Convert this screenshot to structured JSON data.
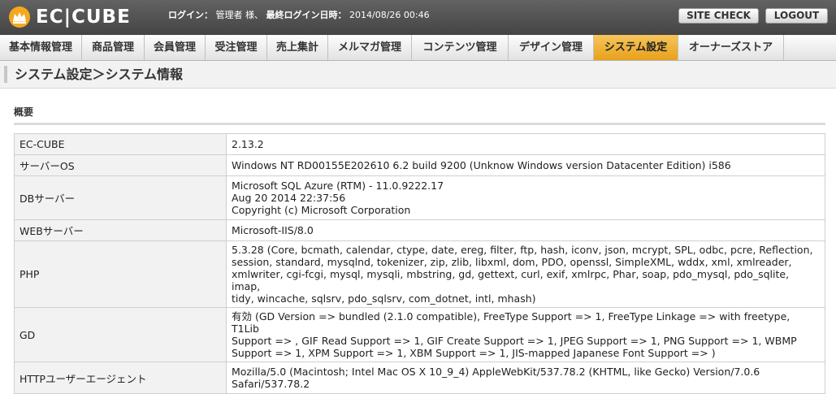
{
  "header": {
    "logo_text": "EC|CUBE",
    "login_label": "ログイン：",
    "user_name": "管理者 様、",
    "last_login_label": "最終ログイン日時：",
    "last_login_value": "2014/08/26 00:46",
    "site_check_label": "SITE CHECK",
    "logout_label": "LOGOUT",
    "brand_color": "#f4a91c"
  },
  "nav": {
    "items": [
      {
        "label": "基本情報管理"
      },
      {
        "label": "商品管理"
      },
      {
        "label": "会員管理"
      },
      {
        "label": "受注管理"
      },
      {
        "label": "売上集計"
      },
      {
        "label": "メルマガ管理"
      },
      {
        "label": "コンテンツ管理"
      },
      {
        "label": "デザイン管理"
      },
      {
        "label": "システム設定",
        "active": true
      },
      {
        "label": "オーナーズストア"
      }
    ],
    "active_color": "#f0b23b"
  },
  "page": {
    "title": "システム設定＞システム情報",
    "section_title": "概要"
  },
  "table": {
    "rows": [
      {
        "label": "EC-CUBE",
        "value": "2.13.2"
      },
      {
        "label": "サーバーOS",
        "value": "Windows NT RD00155E202610 6.2 build 9200 (Unknow Windows version Datacenter Edition) i586"
      },
      {
        "label": "DBサーバー",
        "value": "Microsoft SQL Azure (RTM) - 11.0.9222.17\nAug 20 2014 22:37:56\nCopyright (c) Microsoft Corporation"
      },
      {
        "label": "WEBサーバー",
        "value": "Microsoft-IIS/8.0"
      },
      {
        "label": "PHP",
        "value": "5.3.28 (Core, bcmath, calendar, ctype, date, ereg, filter, ftp, hash, iconv, json, mcrypt, SPL, odbc, pcre, Reflection,\nsession, standard, mysqlnd, tokenizer, zip, zlib, libxml, dom, PDO, openssl, SimpleXML, wddx, xml, xmlreader,\nxmlwriter, cgi-fcgi, mysql, mysqli, mbstring, gd, gettext, curl, exif, xmlrpc, Phar, soap, pdo_mysql, pdo_sqlite, imap,\ntidy, wincache, sqlsrv, pdo_sqlsrv, com_dotnet, intl, mhash)"
      },
      {
        "label": "GD",
        "value": "有効 (GD Version => bundled (2.1.0 compatible), FreeType Support => 1, FreeType Linkage => with freetype, T1Lib\nSupport => , GIF Read Support => 1, GIF Create Support => 1, JPEG Support => 1, PNG Support => 1, WBMP\nSupport => 1, XPM Support => 1, XBM Support => 1, JIS-mapped Japanese Font Support => )"
      },
      {
        "label": "HTTPユーザーエージェント",
        "value": "Mozilla/5.0 (Macintosh; Intel Mac OS X 10_9_4) AppleWebKit/537.78.2 (KHTML, like Gecko) Version/7.0.6\nSafari/537.78.2"
      }
    ]
  }
}
